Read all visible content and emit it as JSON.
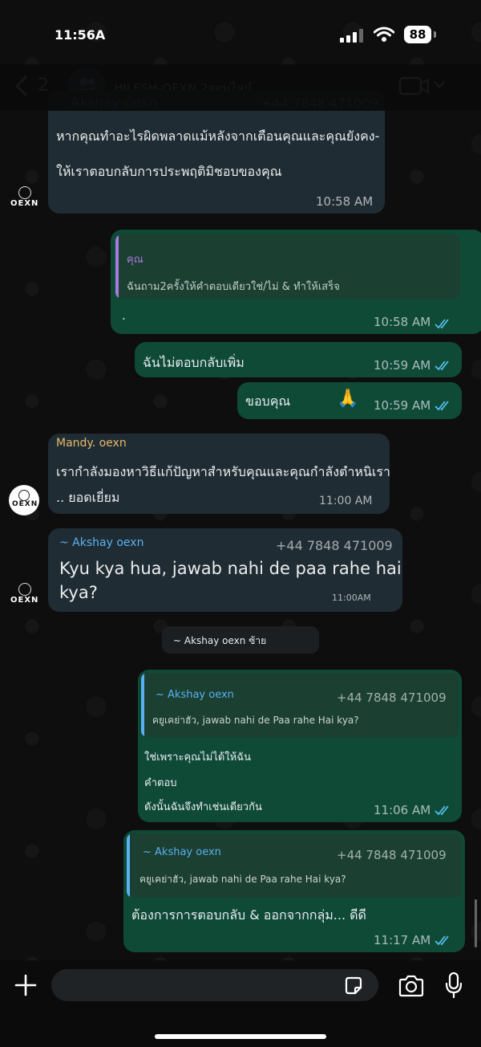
{
  "status": {
    "time": "11:56A",
    "battery": "88"
  },
  "header": {
    "back_count": "2",
    "title": "HILESH-OEXN 2ออนไลน์"
  },
  "messages": {
    "m1": {
      "header": "Akshay oexn",
      "header_phone": "+44 7848 471009",
      "line1": "หากคุณทำอะไรผิดพลาดแม้หลังจากเตือนคุณและคุณยังคง-",
      "line2": "ให้เราตอบกลับการประพฤติมิชอบของคุณ",
      "time": "10:58 AM"
    },
    "m2": {
      "quote_author": "คุณ",
      "quote_text": "ฉันถาม2ครั้งให้คำตอบเดียวใช่/ไม่ & ทำให้เสร็จ",
      "text": ".",
      "time": "10:58 AM"
    },
    "m3": {
      "text": "ฉันไม่ตอบกลับเพิ่ม",
      "time": "10:59 AM"
    },
    "m4": {
      "text": "ขอบคุณ",
      "emoji": "🙏",
      "time": "10:59 AM"
    },
    "m5": {
      "sender": "Mandy. oexn",
      "line1": "เรากำลังมองหาวิธีแก้ปัญหาสำหรับคุณและคุณกำลังตำหนิเรา",
      "line2": ".. ยอดเยี่ยม",
      "time": "11:00 AM"
    },
    "m6": {
      "sender": "~ Akshay oexn",
      "phone": "+44 7848 471009",
      "line1": "Kyu kya hua, jawab nahi de paa rahe hai",
      "line2": "kya?",
      "time": "11:00AM"
    },
    "system": "~ Akshay oexn ซ้าย",
    "m7": {
      "quote_author": "~ Akshay oexn",
      "quote_phone": "+44 7848 471009",
      "quote_text": "คยูเคย่าฮัว, jawab nahi de Paa rahe Hai kya?",
      "line1": "ใช่เพราะคุณไม่ได้ให้ฉัน",
      "line2": "คำตอบ",
      "line3": "ดังนั้นฉันจึงทำเช่นเดียวกัน",
      "time": "11:06 AM"
    },
    "m8": {
      "quote_author": "~ Akshay oexn",
      "quote_phone": "+44 7848 471009",
      "quote_text": "คยูเคย่าฮัว, jawab nahi de Paa rahe Hai kya?",
      "text": "ต้องการการตอบกลับ & ออกจากกลุ่ม... ดีดี",
      "time": "11:17 AM"
    }
  },
  "avatars": {
    "oexn_label": "OEXN"
  },
  "composer": {
    "placeholder": ""
  },
  "colors": {
    "incoming_bubble": "#202c33",
    "outgoing_bubble": "#0f4a37",
    "read_ticks": "#53bdeb",
    "quote_bar_self": "#a77be0",
    "quote_bar_contact": "#5ab0f0",
    "sender_mandy": "#e9b86a",
    "sender_akshay": "#5ab0f0"
  }
}
